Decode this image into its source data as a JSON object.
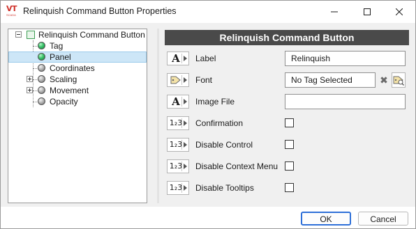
{
  "window": {
    "title": "Relinquish Command Button Properties",
    "logo_text": "VT",
    "logo_subtext": "SCADA",
    "accent": "#d0322b"
  },
  "tree": {
    "root": {
      "label": "Relinquish Command Button",
      "icon": "root-object-icon"
    },
    "items": [
      {
        "label": "Tag",
        "icon": "green-ball-icon",
        "selected": false
      },
      {
        "label": "Panel",
        "icon": "green-ball-icon",
        "selected": true
      },
      {
        "label": "Coordinates",
        "icon": "gray-ball-icon",
        "selected": false
      },
      {
        "label": "Scaling",
        "icon": "gray-ball-icon",
        "expandable": true
      },
      {
        "label": "Movement",
        "icon": "gray-ball-icon",
        "expandable": true
      },
      {
        "label": "Opacity",
        "icon": "gray-ball-icon",
        "selected": false
      }
    ],
    "selection_color": "#cde6f7"
  },
  "properties": {
    "header": "Relinquish Command Button",
    "rows": [
      {
        "label": "Label",
        "icon": "text-A-icon",
        "type": "text",
        "value": "Relinquish"
      },
      {
        "label": "Font",
        "icon": "tag-icon",
        "type": "text",
        "value": "No Tag Selected"
      },
      {
        "label": "Image File",
        "icon": "text-A-icon",
        "type": "text",
        "value": ""
      },
      {
        "label": "Confirmation",
        "icon": "numeric-123-icon",
        "type": "checkbox",
        "checked": false
      },
      {
        "label": "Disable Control",
        "icon": "numeric-123-icon",
        "type": "checkbox",
        "checked": false
      },
      {
        "label": "Disable Context Menu",
        "icon": "numeric-123-icon",
        "type": "checkbox",
        "checked": false
      },
      {
        "label": "Disable Tooltips",
        "icon": "numeric-123-icon",
        "type": "checkbox",
        "checked": false
      }
    ],
    "glyph_text": "A",
    "glyph_numeric": "1₂3",
    "clear_symbol": "✖"
  },
  "footer": {
    "ok_label": "OK",
    "cancel_label": "Cancel",
    "default_button_color": "#2d6fd8"
  }
}
